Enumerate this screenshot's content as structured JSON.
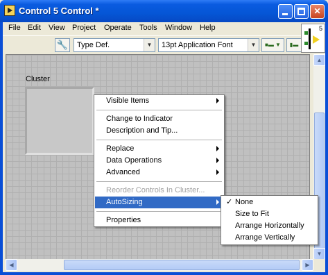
{
  "window": {
    "title": "Control 5 Control *"
  },
  "menu": [
    "File",
    "Edit",
    "View",
    "Project",
    "Operate",
    "Tools",
    "Window",
    "Help"
  ],
  "toolbar": {
    "typedef_value": "Type Def.",
    "font_value": "13pt Application Font"
  },
  "connector_pane": {
    "number": "5"
  },
  "canvas": {
    "cluster_label": "Cluster"
  },
  "context_menu": {
    "items": [
      {
        "label": "Visible Items",
        "submenu": true
      },
      {
        "label": "Change to Indicator"
      },
      {
        "label": "Description and Tip..."
      },
      {
        "label": "Replace",
        "submenu": true
      },
      {
        "label": "Data Operations",
        "submenu": true
      },
      {
        "label": "Advanced",
        "submenu": true
      },
      {
        "label": "Reorder Controls In Cluster...",
        "disabled": true
      },
      {
        "label": "AutoSizing",
        "submenu": true,
        "highlighted": true
      },
      {
        "label": "Properties"
      }
    ]
  },
  "autosizing_submenu": {
    "check_mark": "✓",
    "items": [
      "None",
      "Size to Fit",
      "Arrange Horizontally",
      "Arrange Vertically"
    ],
    "selected": "None"
  },
  "colors": {
    "titlebar": "#0a5be0",
    "highlight": "#316ac5",
    "canvas_grid": "#c0c0c0"
  }
}
